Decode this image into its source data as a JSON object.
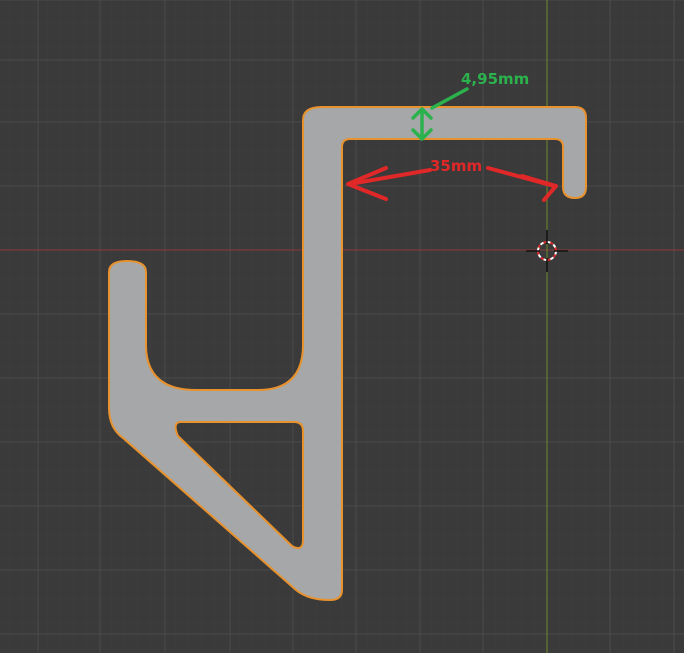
{
  "viewport": {
    "background": "#3a3a3a",
    "grid_minor_color": "#424242",
    "grid_major_color": "#4a4a4a",
    "axis_x_color": "#8b3a3a",
    "axis_y_color": "#6b8a2a"
  },
  "profile": {
    "fill": "#a6a7a9",
    "outline": "#e8922e"
  },
  "dimensions": {
    "thickness": {
      "label": "4,95mm",
      "color": "#2bb24c"
    },
    "width": {
      "label": "35mm",
      "color": "#e02828"
    }
  },
  "cursor": {
    "icon": "3d-cursor-icon"
  }
}
